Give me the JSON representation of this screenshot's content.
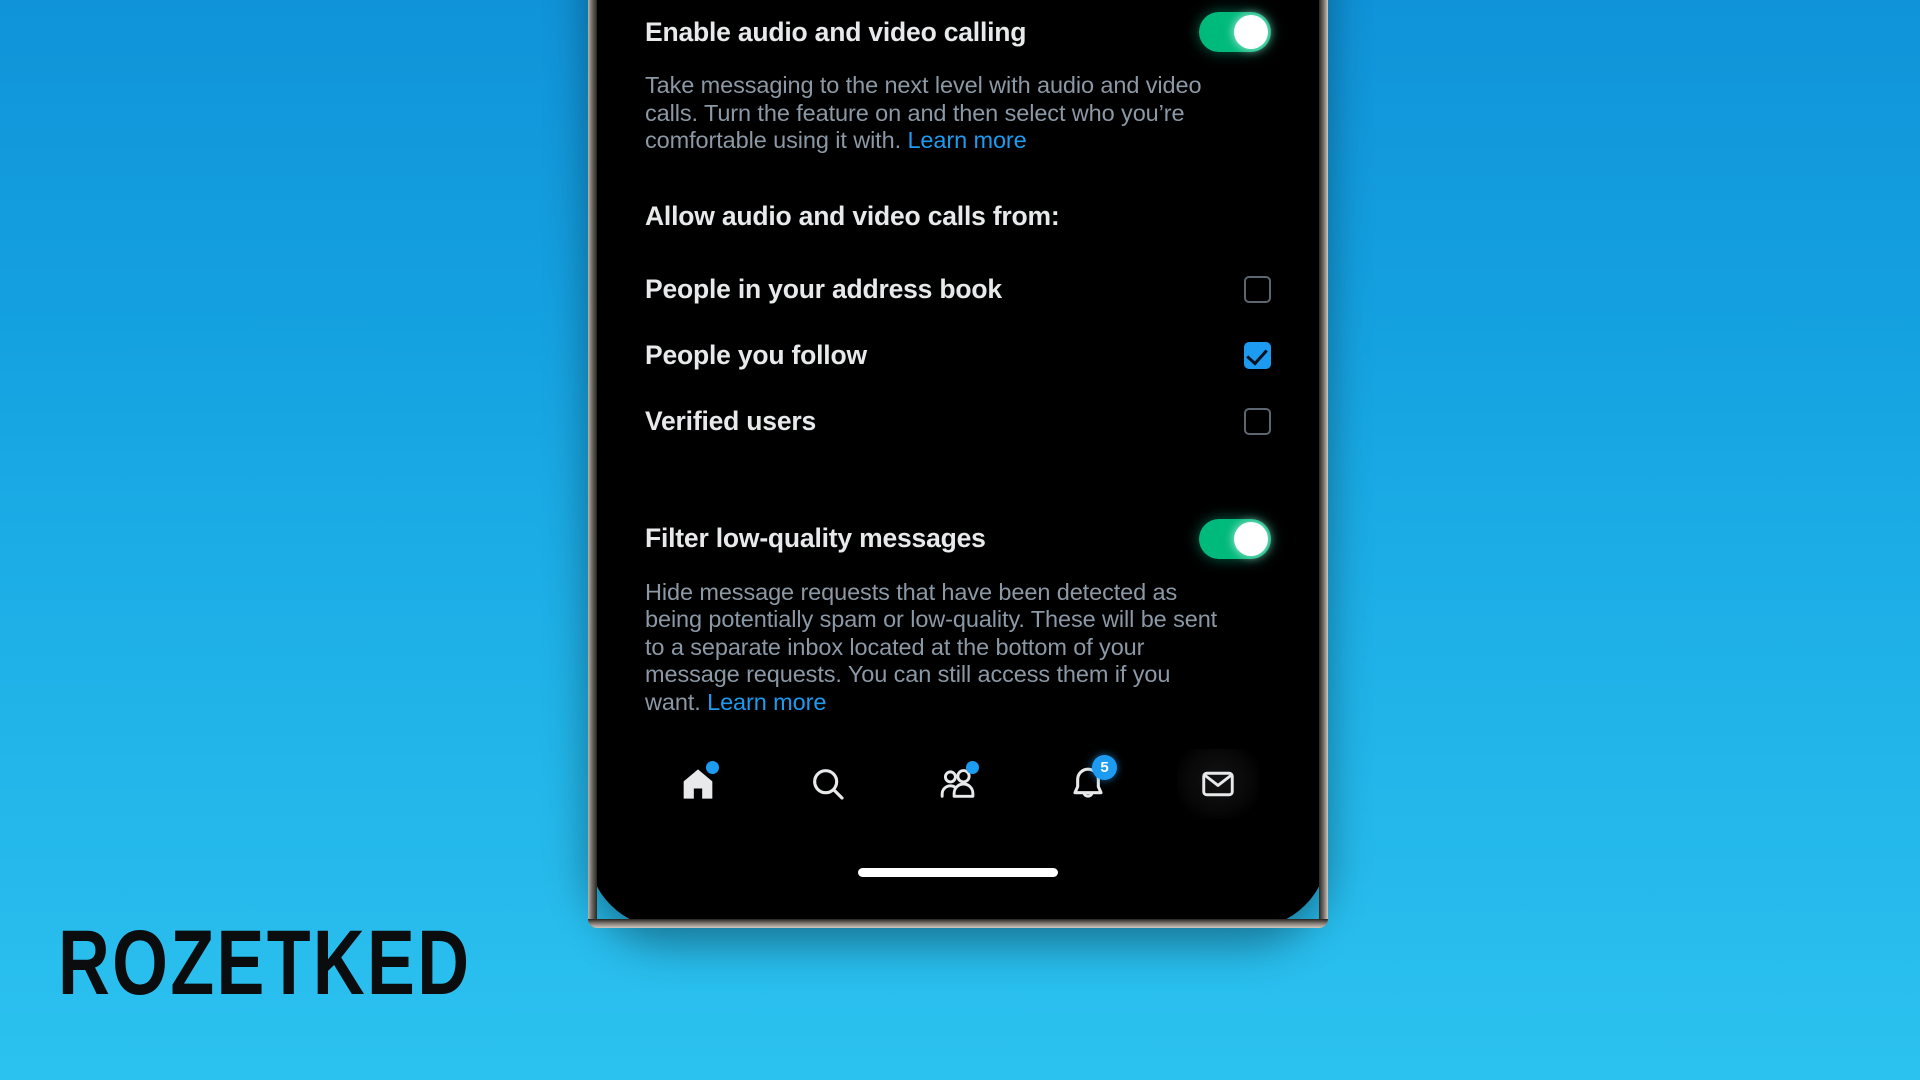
{
  "background": {
    "gradient_top": "#1093D9",
    "gradient_bottom": "#2CC2EF"
  },
  "watermark": {
    "text": "ROZETKED"
  },
  "colors": {
    "accent_blue": "#1d9bf0",
    "toggle_green": "#00ba7c",
    "screen_bg": "#000000",
    "title_text": "#e7e9ea",
    "muted_text": "#8b98a5"
  },
  "settings": {
    "calling": {
      "title": "Enable audio and video calling",
      "toggle_state": "on",
      "description_text": "Take messaging to the next level with audio and video calls. Turn the feature on and then select who you’re comfortable using it with. ",
      "learn_more_label": "Learn more"
    },
    "allow_from": {
      "heading": "Allow audio and video calls from:",
      "options": [
        {
          "label": "People in your address book",
          "checked": false
        },
        {
          "label": "People you follow",
          "checked": true
        },
        {
          "label": "Verified users",
          "checked": false
        }
      ]
    },
    "filter": {
      "title": "Filter low-quality messages",
      "toggle_state": "on",
      "description_text": "Hide message requests that have been detected as being potentially spam or low-quality. These will be sent to a separate inbox located at the bottom of your message requests. You can still access them if you want. ",
      "learn_more_label": "Learn more"
    }
  },
  "bottom_nav": {
    "items": [
      {
        "name": "home",
        "icon": "home-icon",
        "badge_type": "dot",
        "badge_value": "",
        "active": false
      },
      {
        "name": "search",
        "icon": "search-icon",
        "badge_type": "none",
        "badge_value": "",
        "active": false
      },
      {
        "name": "communities",
        "icon": "communities-icon",
        "badge_type": "dot",
        "badge_value": "",
        "active": false
      },
      {
        "name": "notifications",
        "icon": "bell-icon",
        "badge_type": "count",
        "badge_value": "5",
        "active": false
      },
      {
        "name": "messages",
        "icon": "mail-icon",
        "badge_type": "none",
        "badge_value": "",
        "active": true
      }
    ]
  }
}
